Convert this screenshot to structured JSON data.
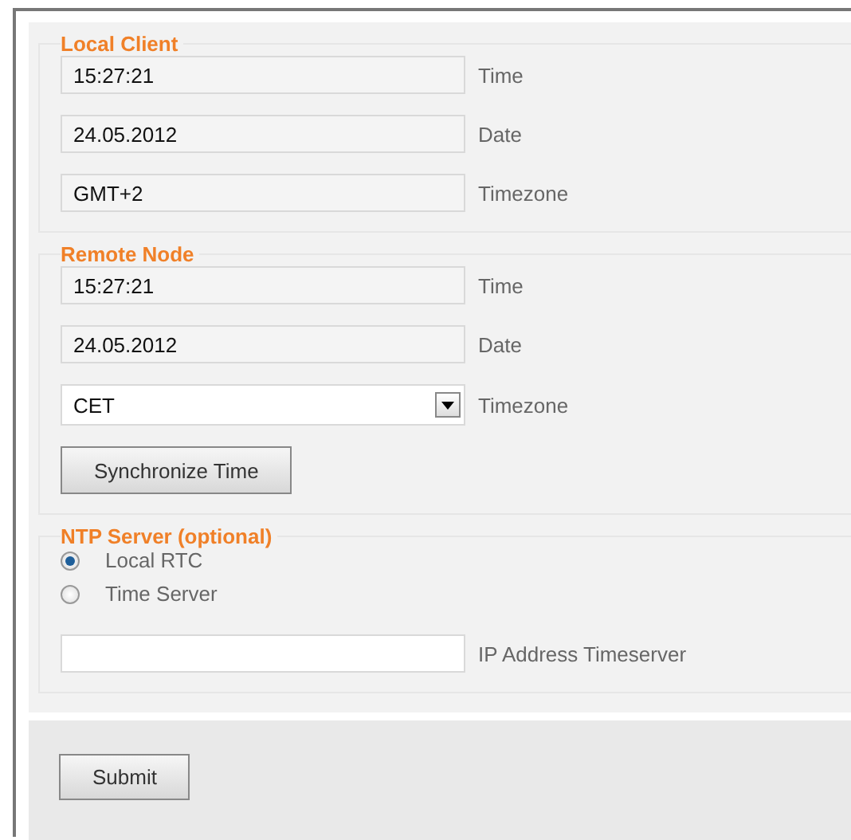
{
  "sections": [
    {
      "legend": "Local Client",
      "items": [
        {
          "kind": "readonly",
          "value": "15:27:21",
          "label": "Time"
        },
        {
          "kind": "readonly",
          "value": "24.05.2012",
          "label": "Date"
        },
        {
          "kind": "readonly",
          "value": "GMT+2",
          "label": "Timezone"
        }
      ]
    },
    {
      "legend": "Remote Node",
      "items": [
        {
          "kind": "readonly",
          "value": "15:27:21",
          "label": "Time"
        },
        {
          "kind": "readonly",
          "value": "24.05.2012",
          "label": "Date"
        },
        {
          "kind": "select",
          "value": "CET",
          "label": "Timezone"
        },
        {
          "kind": "button",
          "label": "Synchronize Time"
        }
      ]
    },
    {
      "legend": "NTP Server (optional)",
      "items": [
        {
          "kind": "radio",
          "label": "Local RTC",
          "selected": true
        },
        {
          "kind": "radio",
          "label": "Time Server",
          "selected": false
        },
        {
          "kind": "input",
          "label": "IP Address Timeserver"
        }
      ]
    }
  ],
  "submit": {
    "label": "Submit"
  }
}
